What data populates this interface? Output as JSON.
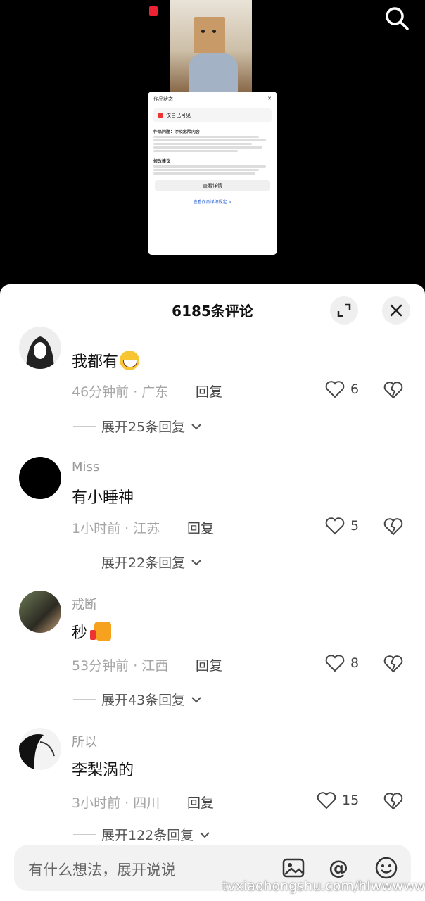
{
  "video": {
    "status_card": {
      "title": "作品状态",
      "alert_title": "仅自己可见",
      "section1": "作品问题：涉及危险内容",
      "section2": "修改建议",
      "button": "查看详情",
      "link": "查看作品详细规定 >"
    }
  },
  "sheet": {
    "title": "6185条评论"
  },
  "comments": [
    {
      "username": "",
      "text": "我都有",
      "time_loc": "46分钟前 · 广东",
      "reply": "回复",
      "likes": "6",
      "expand": "展开25条回复"
    },
    {
      "username": "Miss",
      "text": "有小睡神",
      "time_loc": "1小时前 · 江苏",
      "reply": "回复",
      "likes": "5",
      "expand": "展开22条回复"
    },
    {
      "username": "戒断",
      "text": "秒",
      "time_loc": "53分钟前 · 江西",
      "reply": "回复",
      "likes": "8",
      "expand": "展开43条回复"
    },
    {
      "username": "所以",
      "text": "李梨涡的",
      "time_loc": "3小时前 · 四川",
      "reply": "回复",
      "likes": "15",
      "expand": "展开122条回复"
    }
  ],
  "input": {
    "placeholder": "有什么想法，展开说说"
  },
  "watermark": "tvxiaohongshu.com/hlwwwww",
  "colors": {
    "accent_red": "#e23333",
    "sheet_bg": "#ffffff",
    "input_bg": "#f2f2f2"
  }
}
